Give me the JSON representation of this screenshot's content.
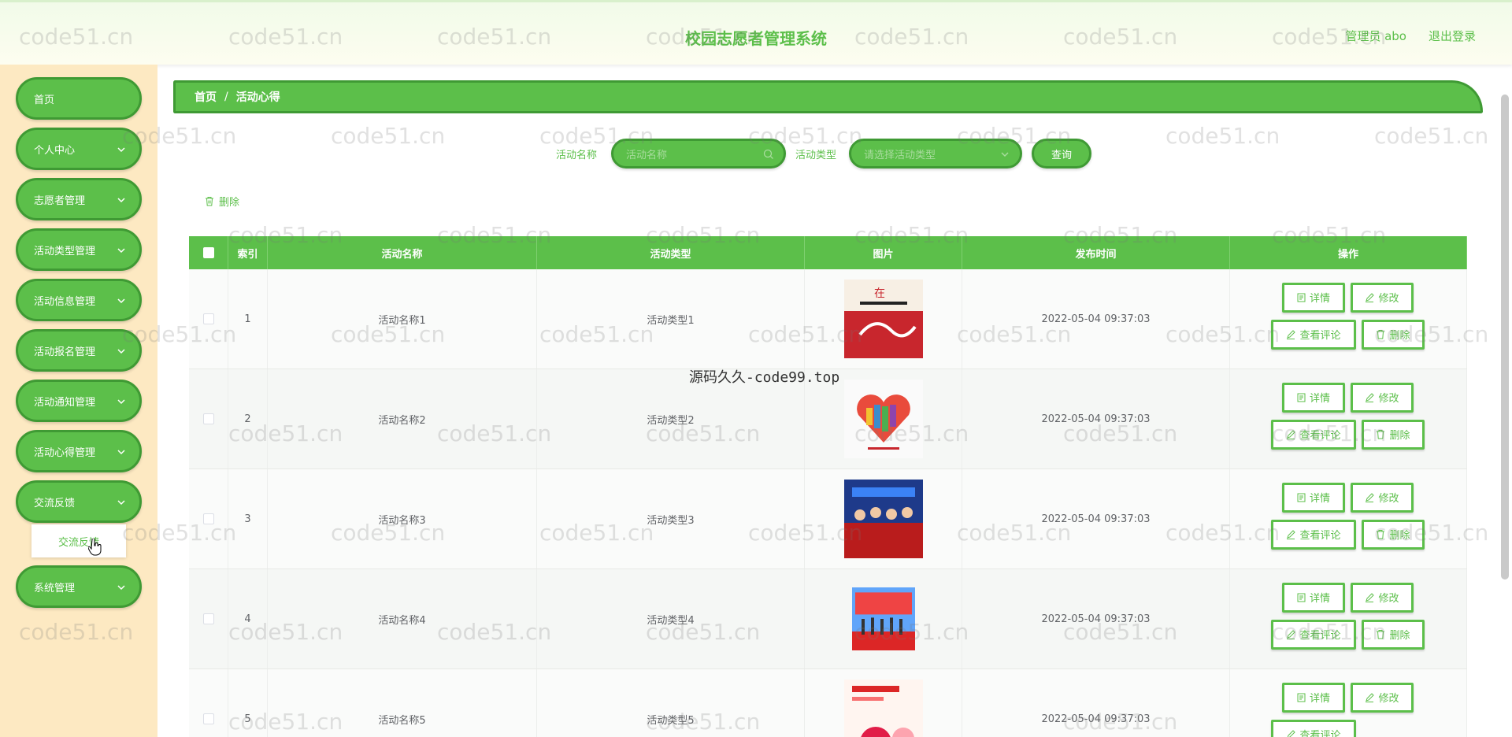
{
  "header": {
    "title": "校园志愿者管理系统",
    "user": "管理员 abo",
    "logout": "退出登录"
  },
  "sidebar": {
    "items": [
      {
        "label": "首页",
        "has_arrow": false
      },
      {
        "label": "个人中心",
        "has_arrow": true
      },
      {
        "label": "志愿者管理",
        "has_arrow": true
      },
      {
        "label": "活动类型管理",
        "has_arrow": true
      },
      {
        "label": "活动信息管理",
        "has_arrow": true
      },
      {
        "label": "活动报名管理",
        "has_arrow": true
      },
      {
        "label": "活动通知管理",
        "has_arrow": true
      },
      {
        "label": "活动心得管理",
        "has_arrow": true
      },
      {
        "label": "交流反馈",
        "has_arrow": true
      },
      {
        "label": "系统管理",
        "has_arrow": true
      }
    ],
    "submenu": {
      "label": "交流反馈"
    }
  },
  "breadcrumb": {
    "home": "首页",
    "separator": "/",
    "current": "活动心得"
  },
  "search": {
    "name_label": "活动名称",
    "name_placeholder": "活动名称",
    "type_label": "活动类型",
    "type_placeholder": "请选择活动类型",
    "query_button": "查询"
  },
  "toolbar": {
    "delete_label": "删除"
  },
  "table": {
    "headers": [
      "索引",
      "活动名称",
      "活动类型",
      "图片",
      "发布时间",
      "操作"
    ],
    "rows": [
      {
        "index": "1",
        "name": "活动名称1",
        "type": "活动类型1",
        "time": "2022-05-04 09:37:03",
        "image": "poster-hands"
      },
      {
        "index": "2",
        "name": "活动名称2",
        "type": "活动类型2",
        "time": "2022-05-04 09:37:03",
        "image": "poster-books-heart"
      },
      {
        "index": "3",
        "name": "活动名称3",
        "type": "活动类型3",
        "time": "2022-05-04 09:37:03",
        "image": "photo-group"
      },
      {
        "index": "4",
        "name": "活动名称4",
        "type": "活动类型4",
        "time": "2022-05-04 09:37:03",
        "image": "photo-ceremony"
      },
      {
        "index": "5",
        "name": "活动名称5",
        "type": "活动类型5",
        "time": "2022-05-04 09:37:03",
        "image": "poster-red"
      }
    ],
    "actions": {
      "detail": "详情",
      "edit": "修改",
      "comments": "查看评论",
      "delete": "删除"
    }
  },
  "watermark": {
    "text": "code51.cn",
    "center_text": "源码久久-code99.top"
  },
  "colors": {
    "primary": "#5cbf4a",
    "primary_dark": "#3f9a34",
    "sidebar_bg": "#fde9c2"
  }
}
